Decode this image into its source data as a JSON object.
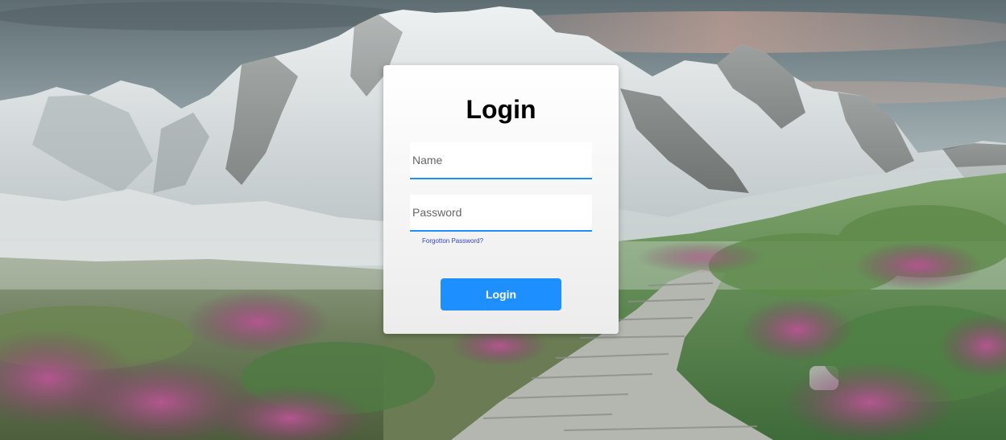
{
  "login": {
    "title": "Login",
    "name_placeholder": "Name",
    "password_placeholder": "Password",
    "forgot_label": "Forgotton Password?",
    "button_label": "Login"
  },
  "colors": {
    "accent": "#1e8fff",
    "link": "#3344cc"
  }
}
